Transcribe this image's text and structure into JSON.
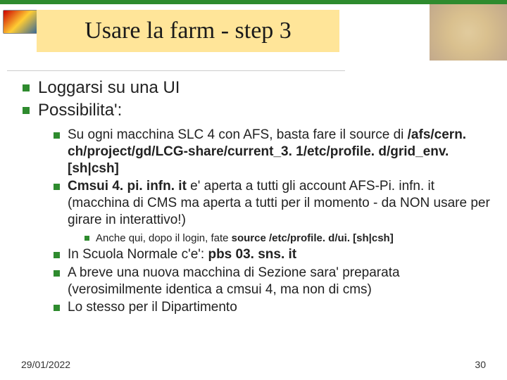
{
  "title": "Usare la farm - step 3",
  "bullets_l1": [
    "Loggarsi su una UI",
    "Possibilita':"
  ],
  "l2a_pre": "Su ogni macchina SLC 4 con AFS, basta fare il source di ",
  "l2a_bold": "/afs/cern. ch/project/gd/LCG-share/current_3. 1/etc/profile. d/grid_env. [sh|csh]",
  "l2b_bold": "Cmsui 4. pi. infn. it",
  "l2b_post": " e' aperta a tutti gli account AFS-Pi. infn. it (macchina di CMS ma aperta a tutti per il momento - da NON usare per girare in interattivo!)",
  "l3_pre": "Anche qui, dopo il login, fate ",
  "l3_bold": "source /etc/profile. d/ui. [sh|csh]",
  "l2c_pre": "In Scuola Normale c'e': ",
  "l2c_bold": "pbs 03. sns. it",
  "l2d": "A breve una nuova macchina di Sezione sara' preparata (verosimilmente identica a cmsui 4, ma non di cms)",
  "l2e": "Lo stesso per il Dipartimento",
  "footer_date": "29/01/2022",
  "footer_page": "30"
}
